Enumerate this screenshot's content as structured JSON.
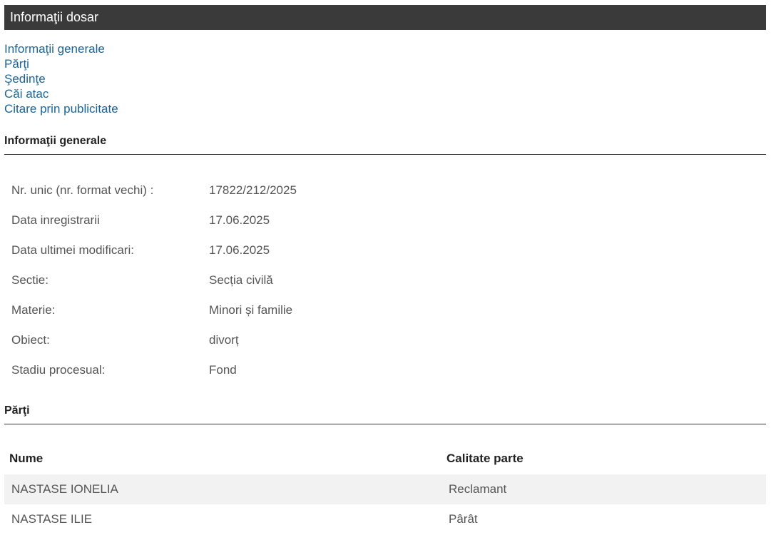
{
  "header": {
    "title": "Informaţii dosar"
  },
  "nav": {
    "links": [
      "Informaţii generale",
      "Părţi",
      "Şedinţe",
      "Căi atac",
      "Citare prin publicitate"
    ]
  },
  "general": {
    "heading": "Informaţii generale",
    "rows": [
      {
        "label": "Nr. unic (nr. format vechi) :",
        "value": "17822/212/2025"
      },
      {
        "label": "Data inregistrarii",
        "value": "17.06.2025"
      },
      {
        "label": "Data ultimei modificari:",
        "value": "17.06.2025"
      },
      {
        "label": "Sectie:",
        "value": "Secția civilă"
      },
      {
        "label": "Materie:",
        "value": "Minori și familie"
      },
      {
        "label": "Obiect:",
        "value": "divorț"
      },
      {
        "label": "Stadiu procesual:",
        "value": "Fond"
      }
    ]
  },
  "parti": {
    "heading": "Părţi",
    "columns": [
      "Nume",
      "Calitate parte"
    ],
    "rows": [
      {
        "nume": "NASTASE IONELIA",
        "calitate": "Reclamant"
      },
      {
        "nume": "NASTASE ILIE",
        "calitate": "Pârât"
      }
    ]
  }
}
